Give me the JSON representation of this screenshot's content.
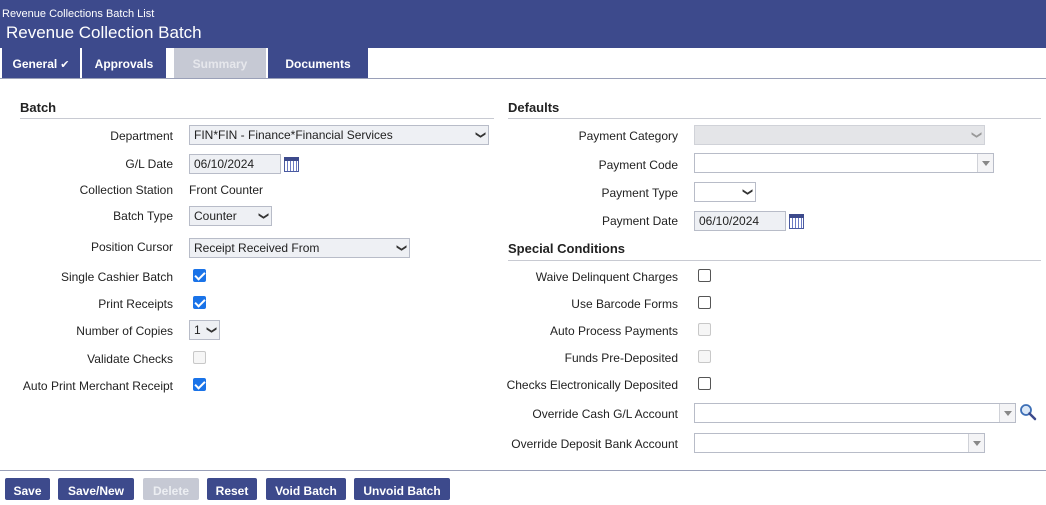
{
  "header": {
    "breadcrumb": "Revenue Collections Batch List",
    "title": "Revenue Collection Batch"
  },
  "tabs": [
    {
      "label": "General",
      "active": true
    },
    {
      "label": "Approvals"
    },
    {
      "label": "Summary",
      "disabled": true
    },
    {
      "label": "Documents"
    }
  ],
  "batch": {
    "section_title": "Batch",
    "department_label": "Department",
    "department_value": "FIN*FIN - Finance*Financial Services",
    "gl_date_label": "G/L Date",
    "gl_date_value": "06/10/2024",
    "collection_station_label": "Collection Station",
    "collection_station_value": "Front Counter",
    "batch_type_label": "Batch Type",
    "batch_type_value": "Counter",
    "position_cursor_label": "Position Cursor",
    "position_cursor_value": "Receipt Received From",
    "single_cashier_label": "Single Cashier Batch",
    "print_receipts_label": "Print Receipts",
    "copies_label": "Number of Copies",
    "copies_value": "1",
    "validate_checks_label": "Validate Checks",
    "auto_print_label": "Auto Print Merchant Receipt"
  },
  "defaults": {
    "section_title": "Defaults",
    "payment_category_label": "Payment Category",
    "payment_code_label": "Payment Code",
    "payment_type_label": "Payment Type",
    "payment_date_label": "Payment Date",
    "payment_date_value": "06/10/2024"
  },
  "special": {
    "section_title": "Special Conditions",
    "waive_label": "Waive Delinquent Charges",
    "barcode_label": "Use Barcode Forms",
    "auto_process_label": "Auto Process Payments",
    "funds_label": "Funds Pre-Deposited",
    "checks_label": "Checks Electronically Deposited",
    "override_cash_label": "Override Cash G/L Account",
    "override_bank_label": "Override Deposit Bank Account"
  },
  "footer": {
    "save": "Save",
    "save_new": "Save/New",
    "delete": "Delete",
    "reset": "Reset",
    "void": "Void Batch",
    "unvoid": "Unvoid Batch"
  },
  "colors": {
    "header_bg": "#3d4a8c",
    "checkbox_checked": "#1a73e8"
  }
}
